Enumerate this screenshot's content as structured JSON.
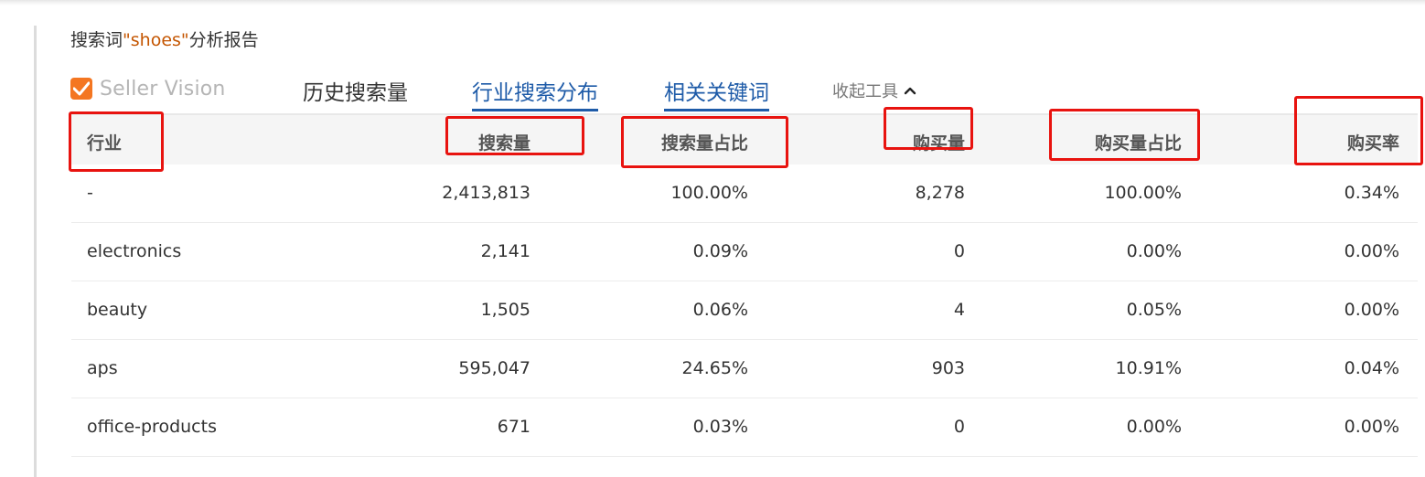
{
  "report": {
    "title_prefix": "搜索词",
    "keyword": "\"shoes\"",
    "title_suffix": "分析报告"
  },
  "brand": {
    "name": "Seller Vision",
    "logo_color": "#f47621"
  },
  "tabs": [
    {
      "label": "历史搜索量",
      "active": false
    },
    {
      "label": "行业搜索分布",
      "active": true
    },
    {
      "label": "相关关键词",
      "active": true
    }
  ],
  "collapse_tool": {
    "label": "收起工具",
    "icon": "chevron-up-icon"
  },
  "table": {
    "headers": [
      "行业",
      "搜索量",
      "搜索量占比",
      "购买量",
      "购买量占比",
      "购买率"
    ],
    "rows": [
      [
        "-",
        "2,413,813",
        "100.00%",
        "8,278",
        "100.00%",
        "0.34%"
      ],
      [
        "electronics",
        "2,141",
        "0.09%",
        "0",
        "0.00%",
        "0.00%"
      ],
      [
        "beauty",
        "1,505",
        "0.06%",
        "4",
        "0.05%",
        "0.00%"
      ],
      [
        "aps",
        "595,047",
        "24.65%",
        "903",
        "10.91%",
        "0.04%"
      ],
      [
        "office-products",
        "671",
        "0.03%",
        "0",
        "0.00%",
        "0.00%"
      ]
    ]
  },
  "colors": {
    "accent": "#1e5ba8",
    "highlight": "#e8130f",
    "keyword": "#c45500"
  }
}
